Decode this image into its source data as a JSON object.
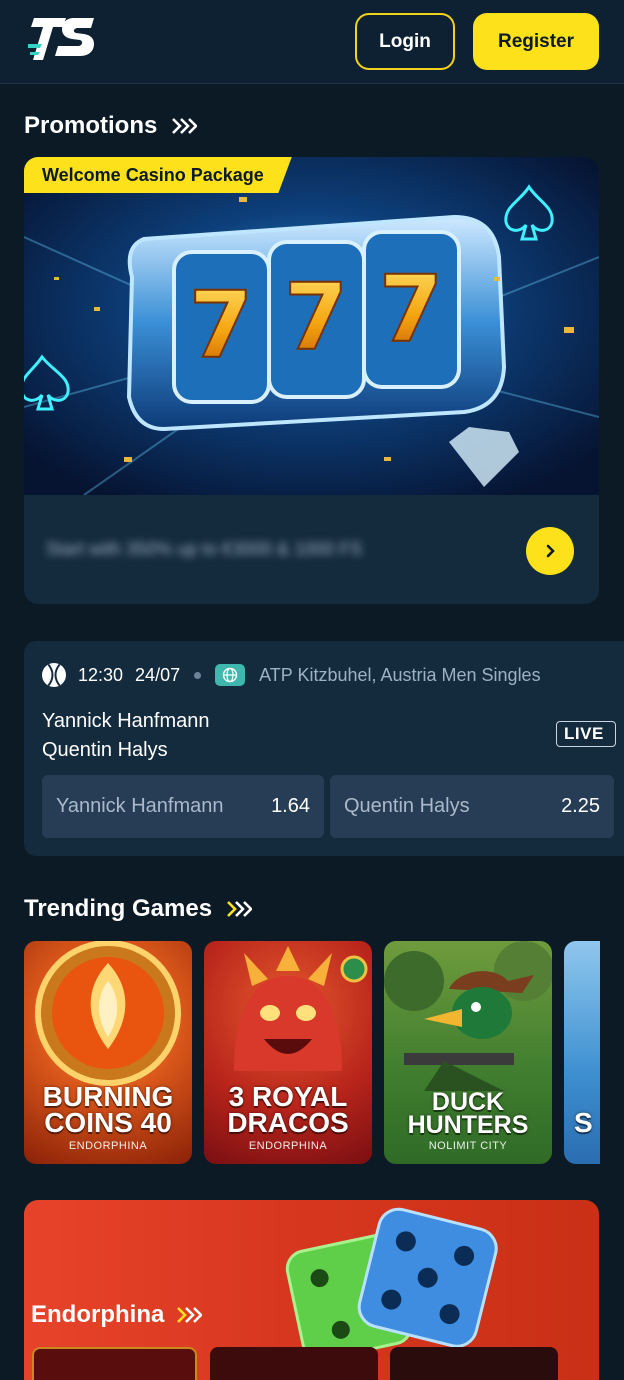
{
  "header": {
    "login_label": "Login",
    "register_label": "Register"
  },
  "promotions": {
    "title": "Promotions",
    "badge": "Welcome Casino Package",
    "description": "Start with 350% up to €3000 & 1000 FS"
  },
  "match": {
    "time": "12:30",
    "date": "24/07",
    "league": "ATP Kitzbuhel, Austria Men Singles",
    "team1": "Yannick Hanfmann",
    "team2": "Quentin Halys",
    "live_label": "LIVE",
    "odds": [
      {
        "name": "Yannick Hanfmann",
        "value": "1.64"
      },
      {
        "name": "Quentin Halys",
        "value": "2.25"
      }
    ]
  },
  "trending": {
    "title": "Trending Games",
    "games": [
      {
        "line1": "BURNING",
        "line2": "COINS 40",
        "provider": "ENDORPHINA"
      },
      {
        "line1": "3 ROYAL",
        "line2": "DRACOS",
        "provider": "ENDORPHINA"
      },
      {
        "line1": "DUCK",
        "line2": "HUNTERS",
        "provider": "NOLIMIT CITY"
      },
      {
        "line1": "S",
        "line2": "",
        "provider": ""
      }
    ]
  },
  "endorphina": {
    "title": "Endorphina"
  },
  "colors": {
    "background": "#0c1a26",
    "accent": "#fde11a",
    "card": "#142a3d"
  }
}
